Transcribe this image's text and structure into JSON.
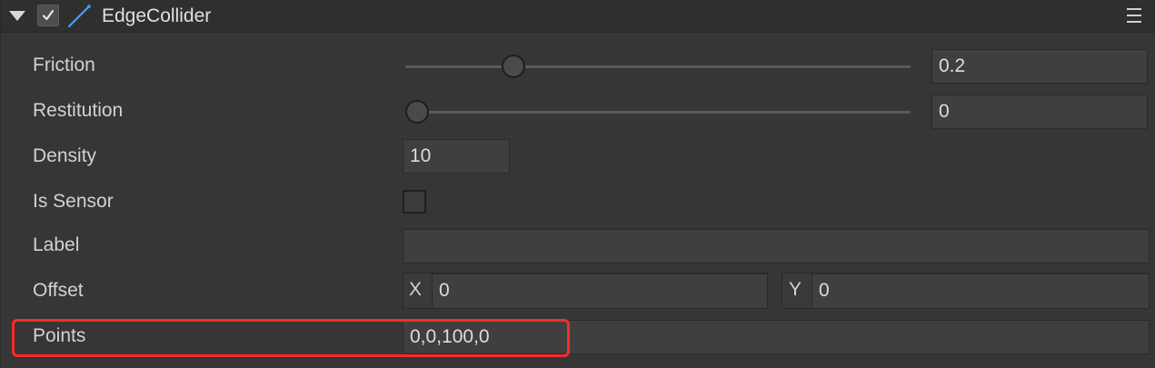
{
  "component": {
    "title": "EdgeCollider",
    "enabled": true,
    "icons": {
      "collapse": "triangle-down-icon",
      "enable": "checkmark-icon",
      "type": "edge-line-icon",
      "menu": "hamburger-menu-icon"
    }
  },
  "properties": {
    "friction": {
      "label": "Friction",
      "value": "0.2",
      "slider_fraction": 0.2
    },
    "restitution": {
      "label": "Restitution",
      "value": "0",
      "slider_fraction": 0
    },
    "density": {
      "label": "Density",
      "value": "10"
    },
    "is_sensor": {
      "label": "Is Sensor",
      "checked": false
    },
    "label": {
      "label": "Label",
      "value": ""
    },
    "offset": {
      "label": "Offset",
      "x_label": "X",
      "x_value": "0",
      "y_label": "Y",
      "y_value": "0"
    },
    "points": {
      "label": "Points",
      "value": "0,0,100,0"
    }
  },
  "colors": {
    "highlight": "#ff2a2a",
    "icon_accent": "#4a9bff"
  }
}
